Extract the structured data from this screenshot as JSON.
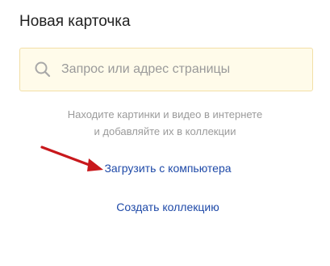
{
  "card": {
    "title": "Новая карточка"
  },
  "search": {
    "placeholder": "Запрос или адрес страницы",
    "value": "",
    "icon": "search-icon"
  },
  "hint": {
    "line1": "Находите картинки и видео в интернете",
    "line2": "и добавляйте их в коллекции"
  },
  "actions": {
    "upload_label": "Загрузить с компьютера",
    "create_collection_label": "Создать коллекцию"
  },
  "colors": {
    "link": "#1f4aa8",
    "arrow": "#c8181c",
    "search_border": "#f2dfa6"
  }
}
